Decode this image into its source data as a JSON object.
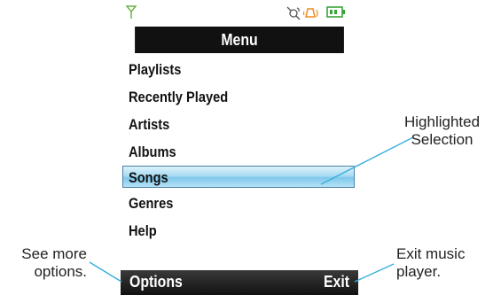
{
  "status_bar": {
    "icons": [
      "signal-strength-icon",
      "satellite-icon",
      "ringer-icon",
      "battery-icon"
    ]
  },
  "menu": {
    "title": "Menu",
    "items": [
      {
        "label": "Playlists"
      },
      {
        "label": "Recently Played"
      },
      {
        "label": "Artists"
      },
      {
        "label": "Albums"
      },
      {
        "label": "Songs",
        "highlighted": true
      },
      {
        "label": "Genres"
      },
      {
        "label": "Help"
      }
    ]
  },
  "soft_keys": {
    "left": "Options",
    "right": "Exit"
  },
  "callouts": {
    "highlight_line1": "Highlighted",
    "highlight_line2": "Selection",
    "options_line1": "See more",
    "options_line2": "options.",
    "exit_line1": "Exit music",
    "exit_line2": "player."
  },
  "colors": {
    "accent_highlight": "#8fd0ee",
    "title_bar": "#111111",
    "callout_line": "#3bb0dc"
  }
}
